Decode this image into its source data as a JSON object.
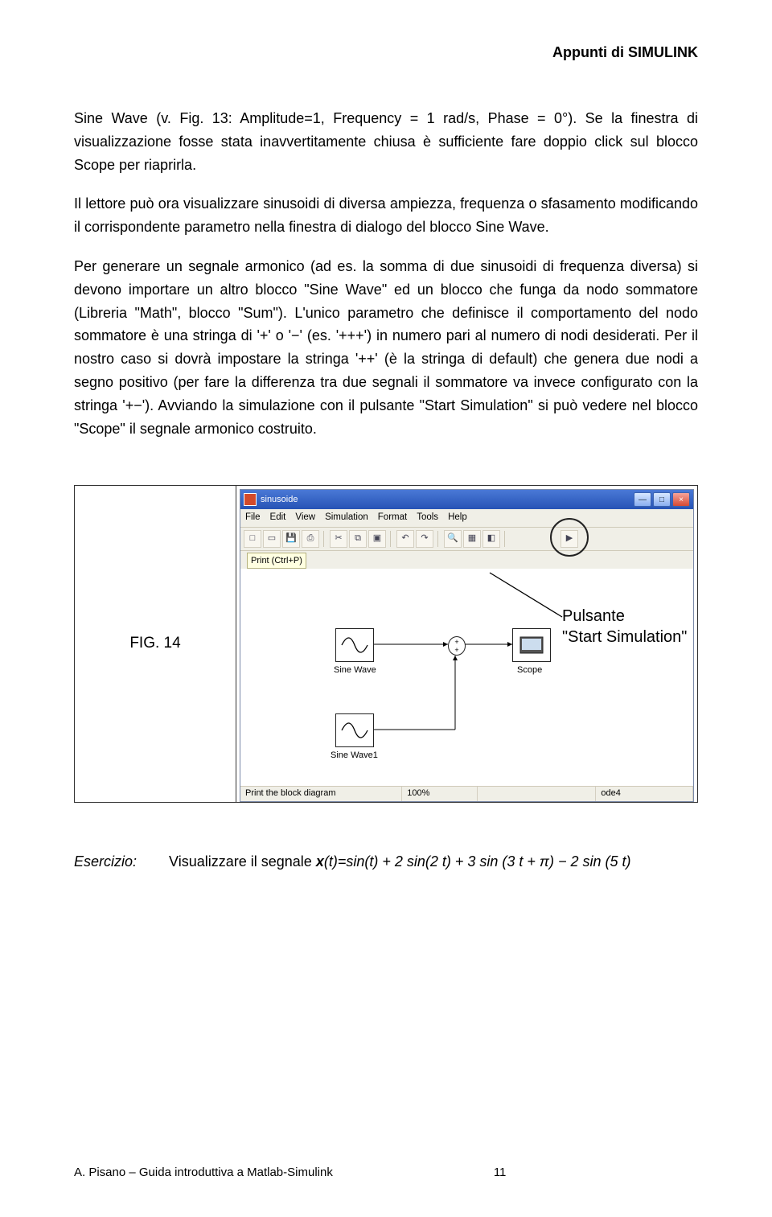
{
  "header": {
    "running_title": "Appunti di SIMULINK"
  },
  "paragraphs": {
    "p1": "Sine Wave (v. Fig. 13: Amplitude=1, Frequency = 1 rad/s, Phase = 0°). Se la finestra di visualizzazione fosse stata inavvertitamente chiusa è sufficiente fare doppio click sul blocco Scope per riaprirla.",
    "p2": "Il lettore può ora visualizzare sinusoidi di diversa ampiezza, frequenza o sfasamento modificando il corrispondente parametro nella finestra di dialogo del blocco Sine Wave.",
    "p3": "Per generare un segnale armonico (ad es. la somma di due sinusoidi di frequenza diversa)  si devono importare un altro blocco \"Sine Wave\" ed un blocco che funga da nodo sommatore (Libreria \"Math\", blocco \"Sum\"). L'unico parametro che definisce il comportamento del nodo sommatore è una stringa di '+' o '−' (es. '+++') in numero pari al numero di nodi desiderati. Per il nostro caso si dovrà impostare la stringa '++' (è la stringa di default) che genera due nodi a segno positivo (per fare la differenza tra due segnali il sommatore va invece configurato con la stringa '+−'). Avviando la simulazione con il pulsante  \"Start Simulation\" si può vedere nel blocco \"Scope\" il segnale armonico costruito."
  },
  "figure": {
    "label": "FIG. 14",
    "window_title": "sinusoide",
    "menu": {
      "file": "File",
      "edit": "Edit",
      "view": "View",
      "simulation": "Simulation",
      "format": "Format",
      "tools": "Tools",
      "help": "Help"
    },
    "tooltip": "Print (Ctrl+P)",
    "status": {
      "left": "Print the block diagram",
      "zoom": "100%",
      "solver": "ode4"
    },
    "annotation_line1": "Pulsante",
    "annotation_line2": "\"Start Simulation\"",
    "blocks": {
      "sine_wave": "Sine Wave",
      "sine_wave1": "Sine Wave1",
      "scope": "Scope"
    }
  },
  "exercise": {
    "label": "Esercizio:",
    "intro": "Visualizzare il segnale ",
    "func_var": "x",
    "equation": "(t)=sin(t) + 2 sin(2 t) + 3 sin (3 t + π) − 2 sin (5 t)"
  },
  "footer": {
    "left": "A. Pisano – Guida introduttiva a Matlab-Simulink",
    "page": "11"
  }
}
